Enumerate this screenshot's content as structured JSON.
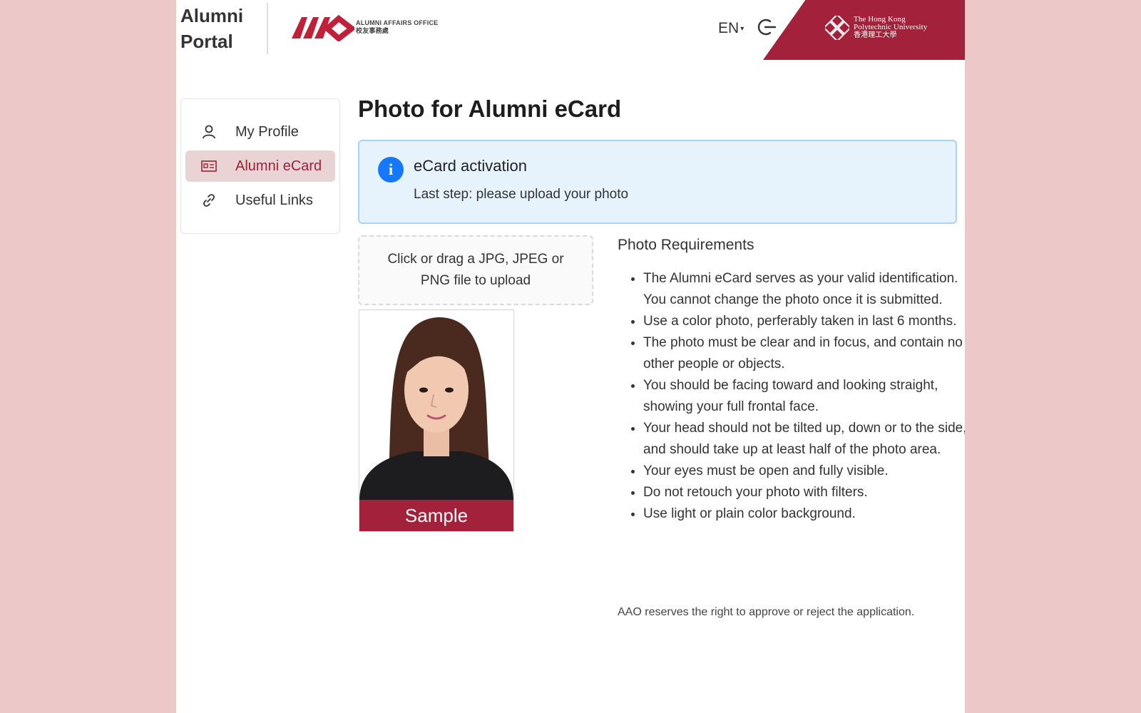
{
  "header": {
    "brand_line1": "Alumni",
    "brand_line2": "Portal",
    "aao_logo_text": "AAO",
    "aao_name_en": "ALUMNI AFFAIRS OFFICE",
    "aao_name_cn": "校友事務處",
    "language": "EN",
    "logout_icon": "logout-icon",
    "university_en_line1": "The Hong Kong",
    "university_en_line2": "Polytechnic University",
    "university_cn": "香港理工大學",
    "brand_color": "#a3213a"
  },
  "sidebar": {
    "items": [
      {
        "label": "My Profile",
        "icon": "user-icon",
        "active": false
      },
      {
        "label": "Alumni eCard",
        "icon": "id-card-icon",
        "active": true
      },
      {
        "label": "Useful Links",
        "icon": "link-icon",
        "active": false
      }
    ],
    "active_bg": "#ead3d5",
    "active_color": "#9e2136"
  },
  "main": {
    "title": "Photo for Alumni eCard",
    "alert": {
      "icon": "info-icon",
      "title": "eCard activation",
      "description": "Last step: please upload your photo"
    },
    "upload": {
      "text": "Click or drag a JPG, JPEG or PNG file to upload"
    },
    "sample_label": "Sample",
    "requirements": {
      "title": "Photo Requirements",
      "items": [
        "The Alumni eCard serves as your valid identification. You cannot change the photo once it is submitted.",
        "Use a color photo, perferably taken in last 6 months.",
        "The photo must be clear and in focus, and contain no other people or objects.",
        "You should be facing toward and looking straight, showing your full frontal face.",
        "Your head should not be tilted up, down or to the side, and should take up at least half of the photo area.",
        "Your eyes must be open and fully visible.",
        "Do not retouch your photo with filters.",
        "Use light or plain color background."
      ]
    },
    "disclaimer": "AAO reserves the right to approve or reject the application."
  }
}
